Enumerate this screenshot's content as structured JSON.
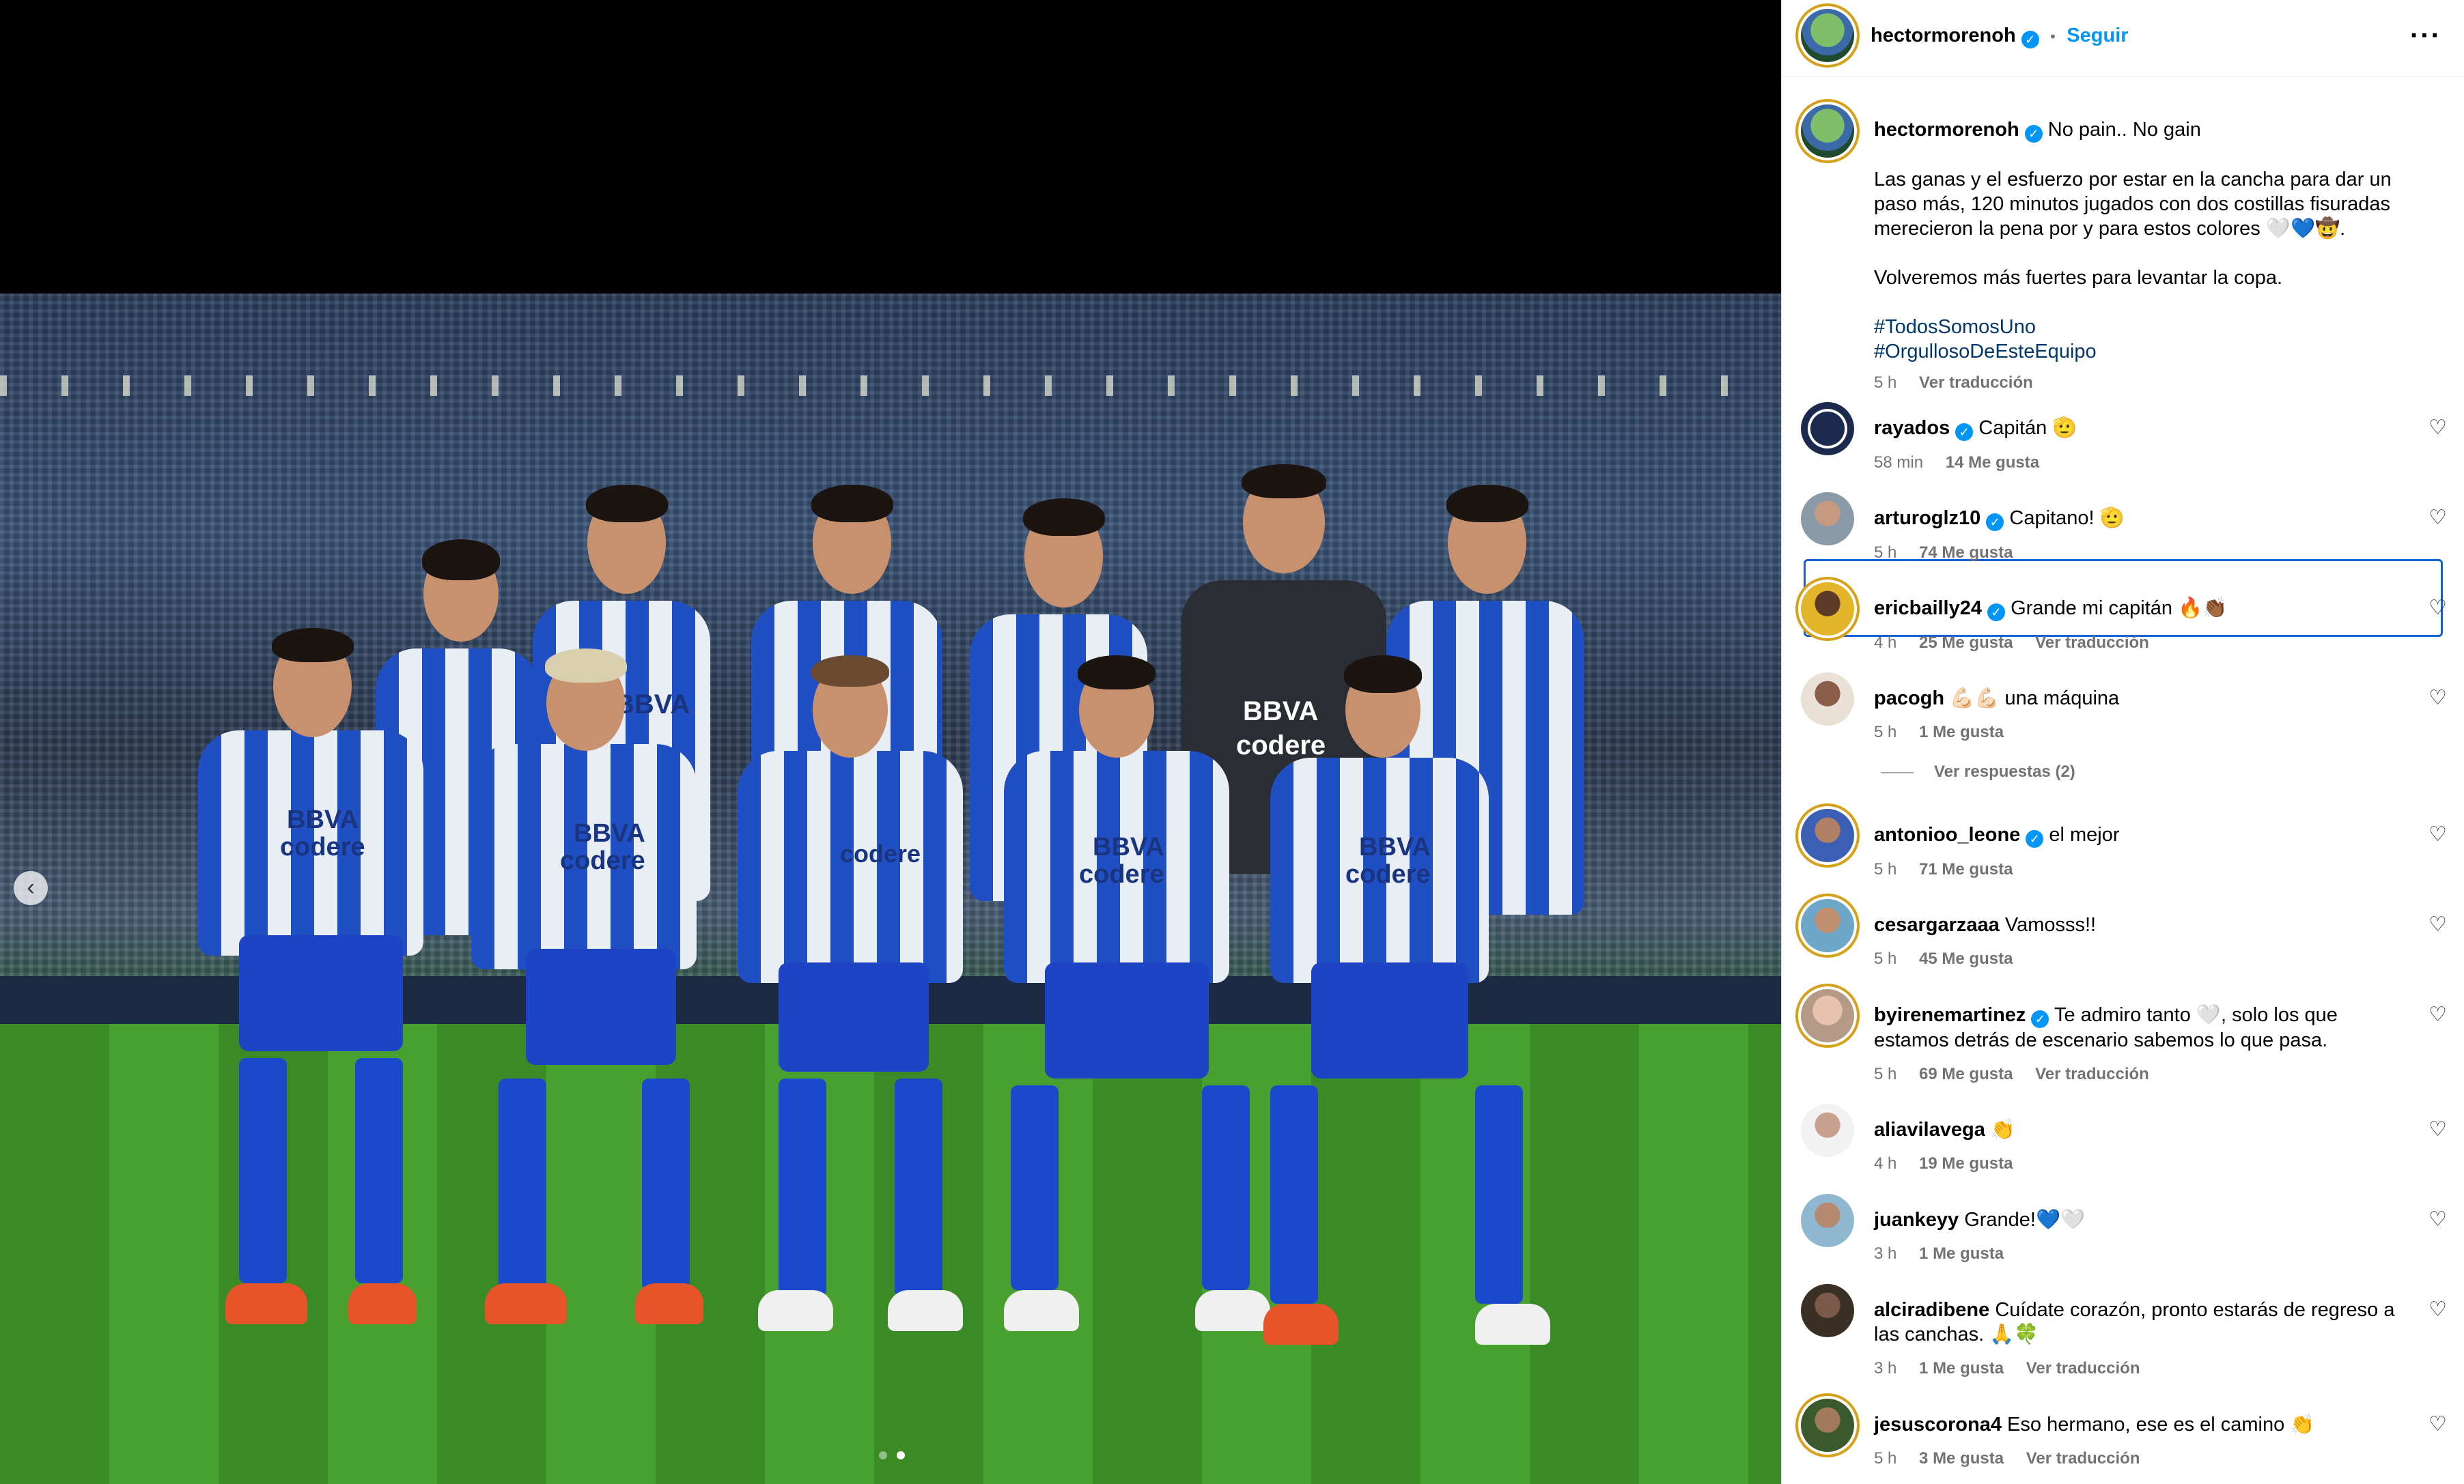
{
  "header": {
    "username": "hectormorenoh",
    "separator": "•",
    "follow_label": "Seguir",
    "more_icon": "more-horizontal-icon"
  },
  "caption": {
    "username": "hectormorenoh",
    "title": "No pain.. No gain",
    "body_1": "Las ganas y el esfuerzo por estar en la cancha para dar un paso más, 120 minutos jugados con dos costillas fisuradas merecieron la pena por y para estos colores 🤍💙🤠.",
    "body_2": "Volveremos más fuertes para levantar la copa.",
    "hashtag_1": "#TodosSomosUno",
    "hashtag_2": "#OrgullosoDeEsteEquipo",
    "time": "5 h",
    "translate": "Ver traducción"
  },
  "comments": [
    {
      "username": "rayados",
      "verified": true,
      "text": "Capitán 🫡",
      "time": "58 min",
      "likes": "14 Me gusta",
      "translate": ""
    },
    {
      "username": "arturoglz10",
      "verified": true,
      "text": "Capitano! 🫡",
      "time": "5 h",
      "likes": "74 Me gusta",
      "translate": ""
    },
    {
      "username": "ericbailly24",
      "verified": true,
      "text": "Grande mi capitán 🔥👏🏾",
      "time": "4 h",
      "likes": "25 Me gusta",
      "translate": "Ver traducción"
    },
    {
      "username": "pacogh",
      "verified": false,
      "text": "💪🏻💪🏻 una máquina",
      "time": "5 h",
      "likes": "1 Me gusta",
      "translate": "",
      "replies": "Ver respuestas (2)"
    },
    {
      "username": "antonioo_leone",
      "verified": true,
      "text": "el mejor",
      "time": "5 h",
      "likes": "71 Me gusta",
      "translate": ""
    },
    {
      "username": "cesargarzaaa",
      "verified": false,
      "text": "Vamosss!!",
      "time": "5 h",
      "likes": "45 Me gusta",
      "translate": ""
    },
    {
      "username": "byirenemartinez",
      "verified": true,
      "text": "Te admiro tanto 🤍, solo los que estamos detrás de escenario sabemos lo que pasa.",
      "time": "5 h",
      "likes": "69 Me gusta",
      "translate": "Ver traducción"
    },
    {
      "username": "aliavilavega",
      "verified": false,
      "text": "👏",
      "time": "4 h",
      "likes": "19 Me gusta",
      "translate": ""
    },
    {
      "username": "juankeyy",
      "verified": false,
      "text": "Grande!💙🤍",
      "time": "3 h",
      "likes": "1 Me gusta",
      "translate": ""
    },
    {
      "username": "alciradibene",
      "verified": false,
      "text": "Cuídate corazón, pronto estarás de regreso a las canchas. 🙏🍀",
      "time": "3 h",
      "likes": "1 Me gusta",
      "translate": "Ver traducción"
    },
    {
      "username": "jesuscorona4",
      "verified": false,
      "text": "Eso hermano, ese es el camino 👏",
      "time": "5 h",
      "likes": "3 Me gusta",
      "translate": "Ver traducción"
    }
  ],
  "media": {
    "prev_icon": "chevron-left-icon",
    "carousel_dots": 2,
    "active_dot": 2,
    "sponsors": {
      "bbva": "BBVA",
      "codere": "codere"
    }
  },
  "colors": {
    "accent": "#0095f6",
    "selection": "#1a5fd0",
    "kit_blue": "#1f4fc2"
  }
}
